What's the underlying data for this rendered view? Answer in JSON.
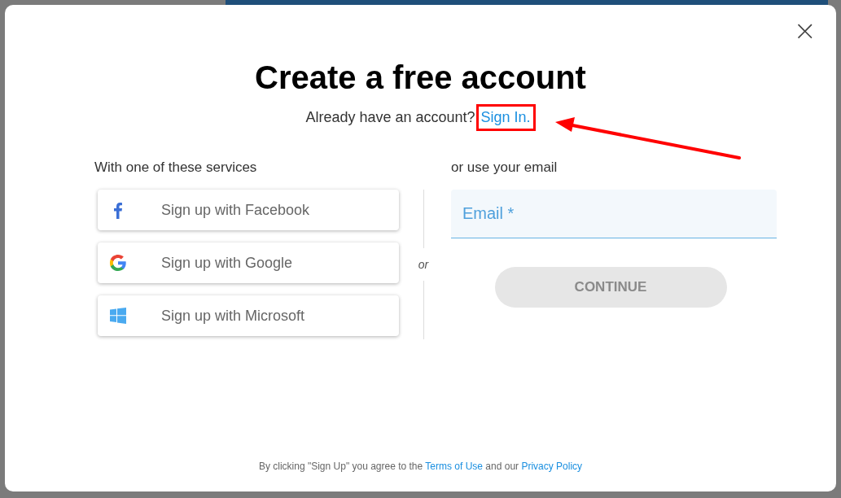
{
  "dialog": {
    "title": "Create a free account",
    "subtitle": "Already have an account?",
    "sign_in_link": "Sign In.",
    "close": "×"
  },
  "services": {
    "label": "With one of these services",
    "buttons": [
      {
        "kind": "facebook",
        "label": "Sign up with Facebook"
      },
      {
        "kind": "google",
        "label": "Sign up with Google"
      },
      {
        "kind": "microsoft",
        "label": "Sign up with Microsoft"
      }
    ]
  },
  "separator": "or",
  "email": {
    "label": "or use your email",
    "placeholder": "Email *",
    "button": "CONTINUE",
    "button_disabled": true
  },
  "footer": {
    "text_before": "By clicking \"Sign Up\" you agree to the ",
    "terms_link": "Terms of Use",
    "text_middle": " and our ",
    "privacy_link": "Privacy Policy"
  }
}
